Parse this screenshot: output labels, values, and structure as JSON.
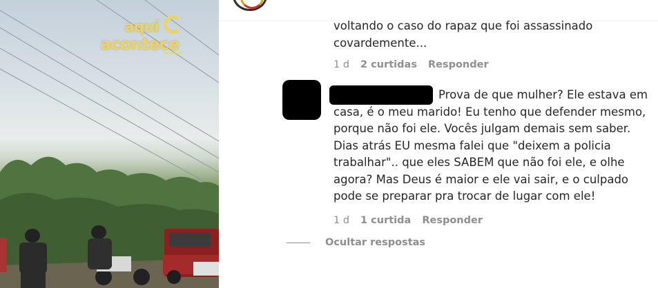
{
  "photo": {
    "watermark": {
      "line1": "aqui",
      "line2": "acontece",
      "line3": "news.br"
    }
  },
  "comments": [
    {
      "text": "voltando o caso do rapaz que foi assassinado covardemente...",
      "time": "1 d",
      "likes": "2 curtidas",
      "reply": "Responder"
    },
    {
      "text": "Prova de que mulher? Ele estava em casa, é o meu marido! Eu tenho que defender mesmo, porque não foi ele. Vocês julgam demais sem saber. Dias atrás EU mesma falei que \"deixem a policia trabalhar\".. que eles SABEM que não foi ele, e olhe agora? Mas Deus é maior e ele vai sair, e o culpado pode se preparar pra trocar de lugar com ele!",
      "time": "1 d",
      "likes": "1 curtida",
      "reply": "Responder"
    }
  ],
  "hide_replies": "Ocultar respostas"
}
